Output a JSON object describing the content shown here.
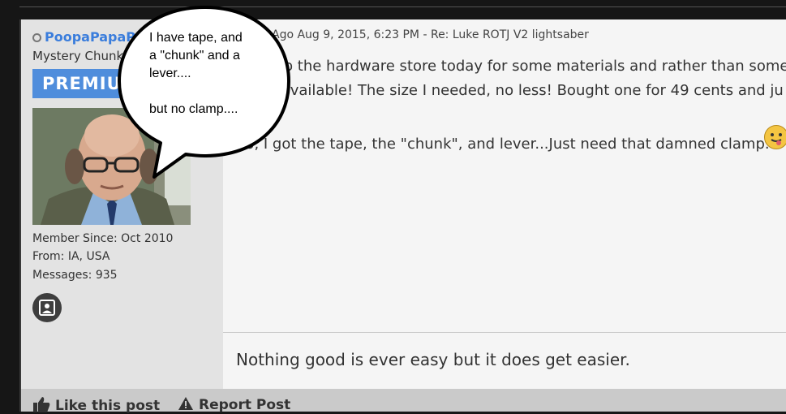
{
  "user": {
    "name": "PoopaPapaP",
    "title": "Mystery Chunk",
    "badge": "PREMIUM",
    "member_since": "Member Since: Oct 2010",
    "from": "From: IA, USA",
    "messages": "Messages: 935"
  },
  "post": {
    "meta": "Ago  Aug 9, 2015, 6:23 PM - Re: Luke ROTJ V2 lightsaber",
    "lines": [
      "Went to the hardware store today for some materials and rather than some",
      "sheet available! The size I needed, no less! Bought one for 49 cents and ju",
      "So, I got the tape, the \"chunk\", and lever...Just need that damned clamp."
    ],
    "signature": "Nothing good is ever easy but it does get easier."
  },
  "actions": {
    "like": "Like this post",
    "report": "Report Post"
  },
  "bubble": {
    "lines": [
      "I have tape, and",
      "a \"chunk\" and a",
      "lever....",
      "",
      "but no clamp...."
    ]
  },
  "colors": {
    "accent": "#3a7ddc",
    "premium": "#4f8ddc",
    "emoji": "#f4c542"
  }
}
